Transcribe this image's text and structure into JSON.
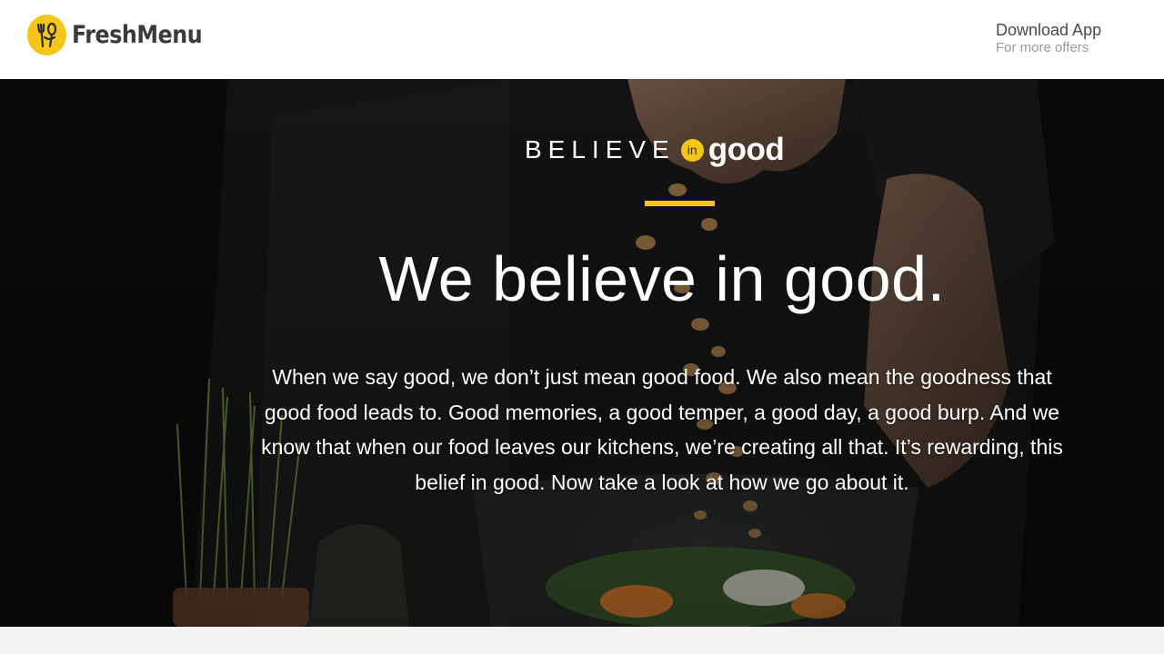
{
  "header": {
    "brand": "FreshMenu",
    "logo_icon": "fork-spoon-icon",
    "download_title": "Download App",
    "download_subtitle": "For more offers"
  },
  "hero": {
    "tagline_believe": "BELIEVE",
    "tagline_in": "in",
    "tagline_good": "good",
    "headline": "We believe in good.",
    "body": "When we say good, we don’t just mean good food. We also mean the goodness that good food leads to. Good memories, a good temper, a good day, a good burp. And we know that when our food leaves our kitchens, we’re creating all that. It’s rewarding, this belief in good. Now take a look at how we go about it."
  },
  "colors": {
    "accent": "#f5c518",
    "header_bg": "#ffffff",
    "hero_bg": "#0d0d0d",
    "brand_text": "#3a3a3a"
  }
}
